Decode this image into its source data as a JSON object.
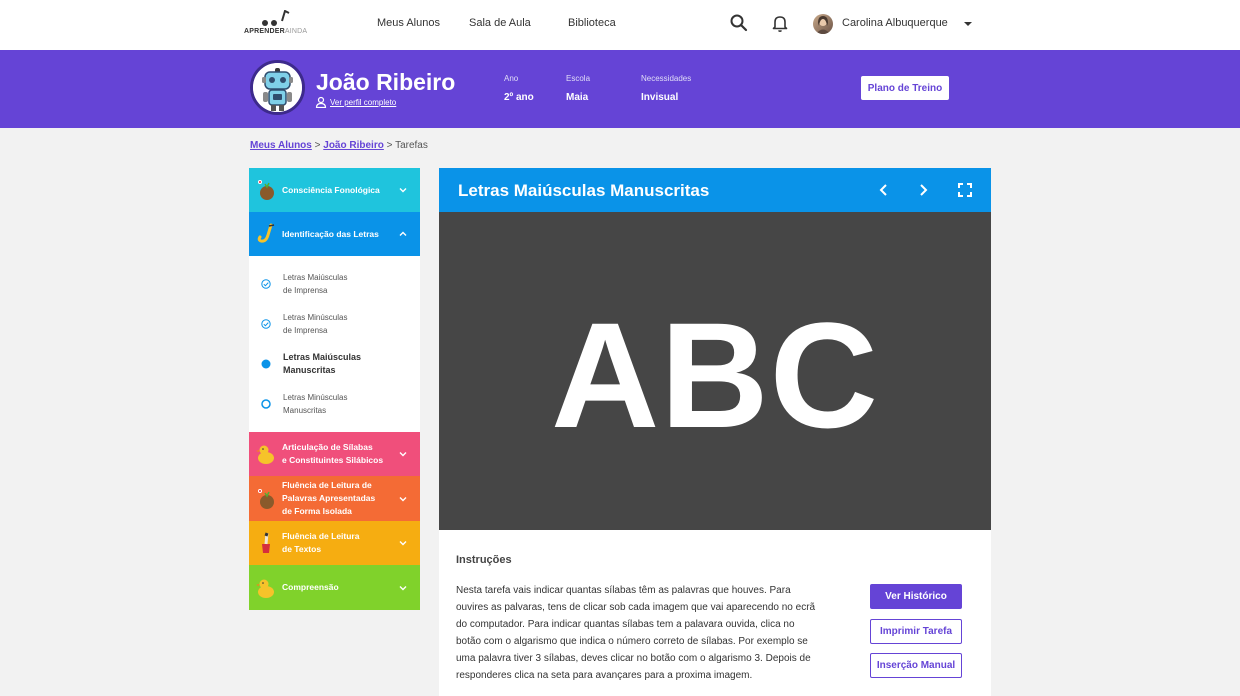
{
  "nav": {
    "logo_main": "APRENDER",
    "logo_accent": "AINDA",
    "links": [
      "Meus Alunos",
      "Sala de Aula",
      "Biblioteca"
    ],
    "user_name": "Carolina Albuquerque"
  },
  "student": {
    "name": "João Ribeiro",
    "profile_link": "Ver perfil completo",
    "ano_label": "Ano",
    "ano_value": "2º ano",
    "escola_label": "Escola",
    "escola_value": "Maia",
    "necessidades_label": "Necessidades",
    "necessidades_value": "Invisual",
    "plan_button": "Plano de Treino"
  },
  "breadcrumb": {
    "item1": "Meus Alunos",
    "item2": "João Ribeiro",
    "current": "Tarefas",
    "separator": ">"
  },
  "sidebar": {
    "categories": [
      {
        "label": "Consciência Fonológica",
        "color": "#1fc4dd"
      },
      {
        "label": "Identificação das Letras",
        "color": "#0a93e8"
      },
      {
        "label_line1": "Articulação de Sílabas",
        "label_line2": "e Constituintes Silábicos",
        "color": "#f04f7b"
      },
      {
        "label_line1": "Fluência de Leitura de",
        "label_line2": "Palavras Apresentadas",
        "label_line3": "de Forma Isolada",
        "color": "#f46b35"
      },
      {
        "label_line1": "Fluência de Leitura",
        "label_line2": "de Textos",
        "color": "#f6ad11"
      },
      {
        "label": "Compreensão",
        "color": "#80d22b"
      }
    ],
    "subitems": [
      {
        "line1": "Letras Maiúsculas",
        "line2": "de Imprensa",
        "status": "done"
      },
      {
        "line1": "Letras Minúsculas",
        "line2": "de Imprensa",
        "status": "done"
      },
      {
        "line1": "Letras Maiúsculas",
        "line2": "Manuscritas",
        "status": "current"
      },
      {
        "line1": "Letras Minúsculas",
        "line2": "Manuscritas",
        "status": "todo"
      }
    ]
  },
  "task": {
    "title": "Letras Maiúsculas Manuscritas",
    "stage_text": "ABC",
    "instructions_title": "Instruções",
    "instructions": [
      "Nesta tarefa vais indicar quantas sílabas têm as palavras que houves. Para",
      "ouvires as palvaras, tens de clicar sob cada imagem que vai aparecendo no ecrã",
      "do computador. Para indicar quantas sílabas tem a palavara ouvida, clica no",
      "botão com o algarismo que indica o número correto de sílabas. Por exemplo se",
      "uma palavra tiver 3 sílabas, deves clicar no botão com o algarismo 3. Depois de",
      "responderes clica na seta para avançares para a proxima imagem."
    ],
    "btn_history": "Ver Histórico",
    "btn_print": "Imprimir Tarefa",
    "btn_manual": "Inserção Manual"
  }
}
